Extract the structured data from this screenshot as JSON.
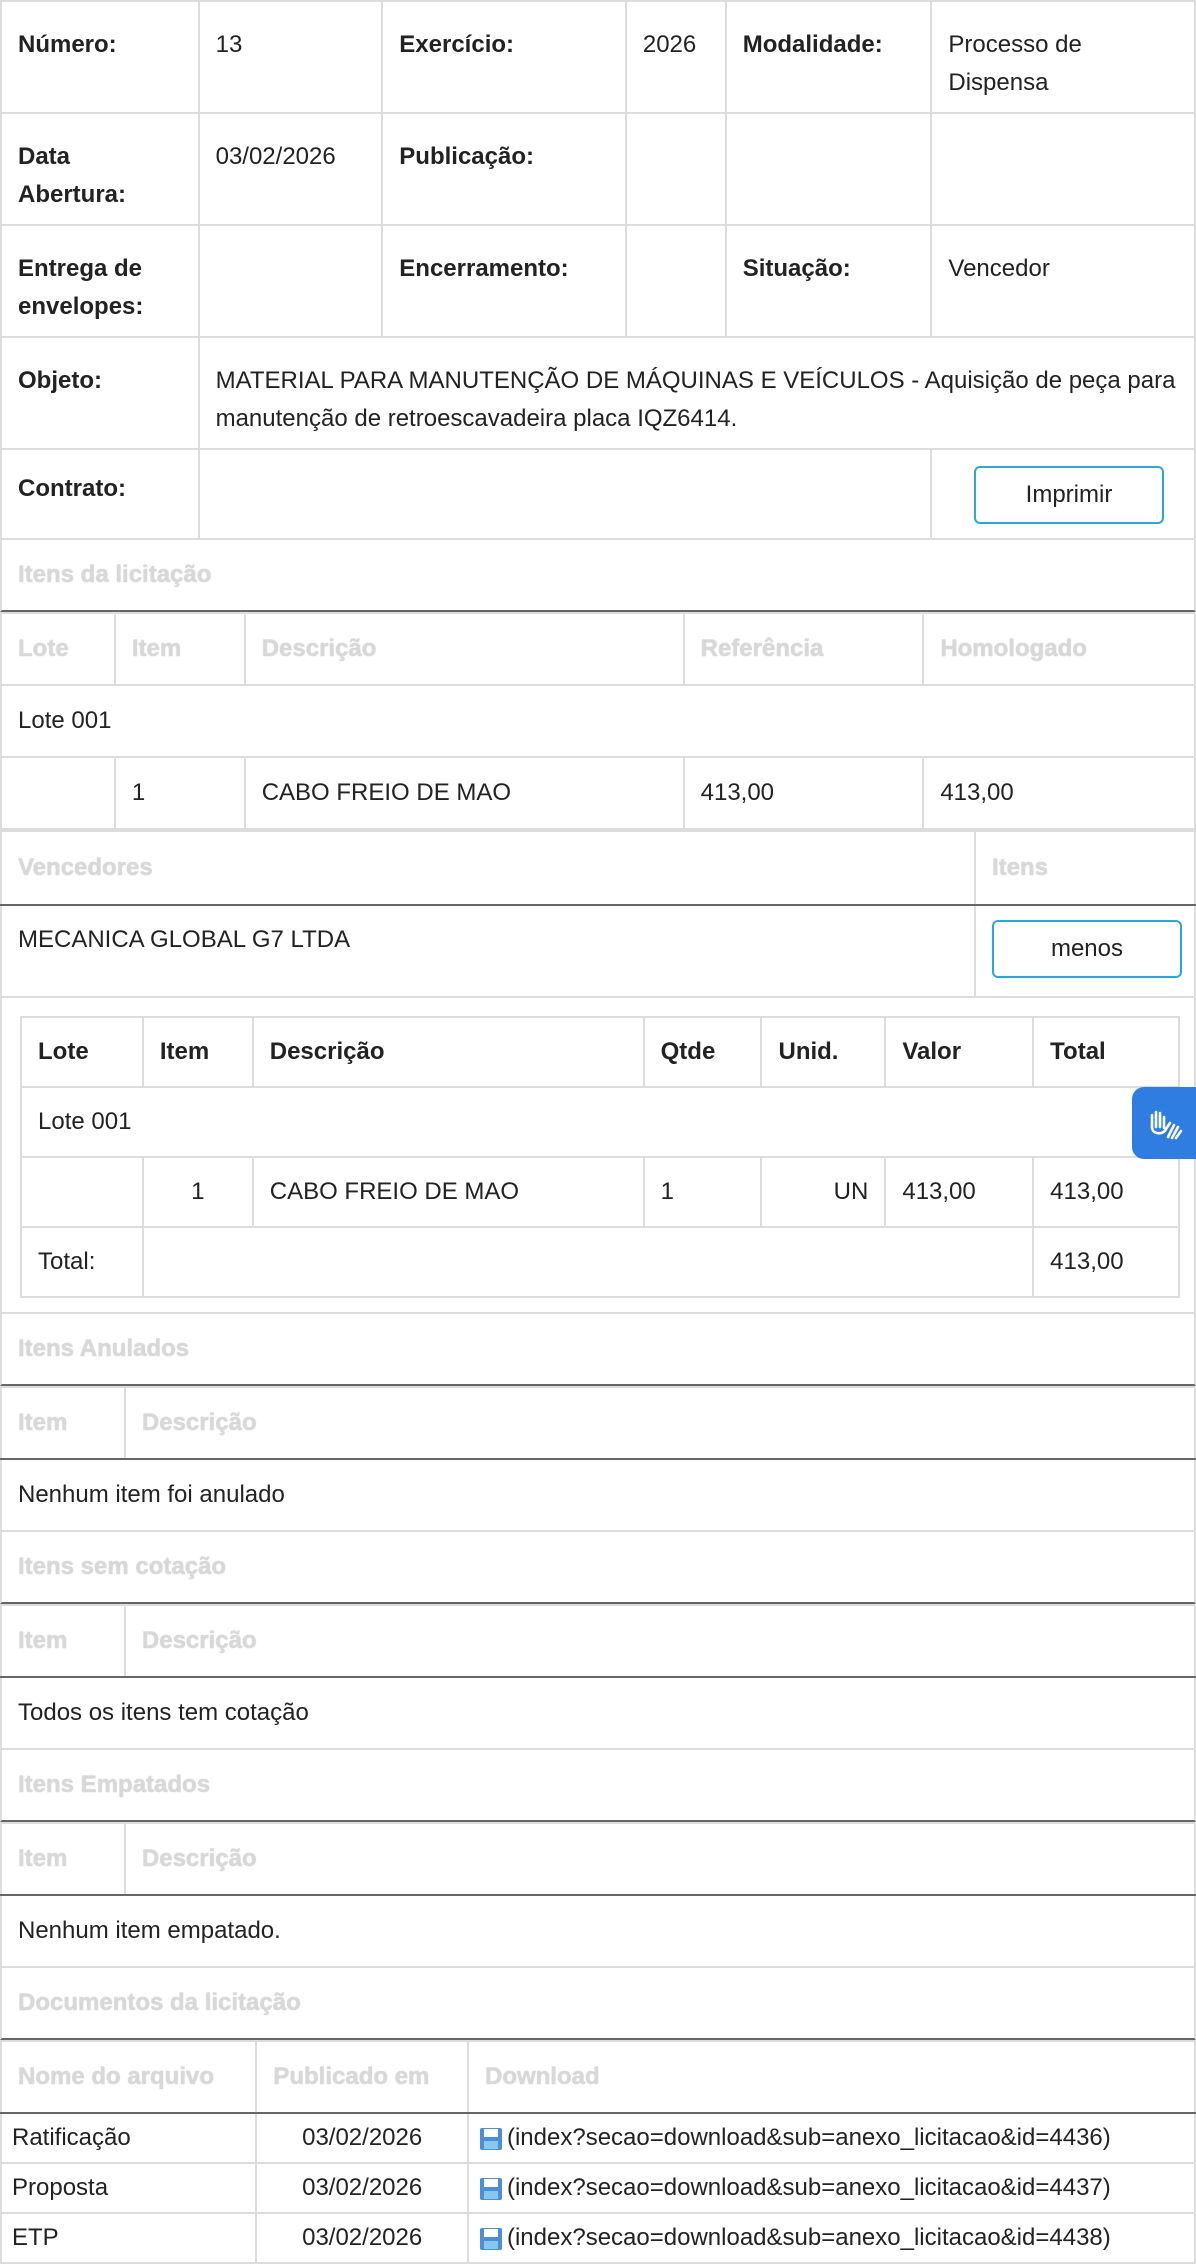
{
  "info": {
    "numero_label": "Número:",
    "numero": "13",
    "exercicio_label": "Exercício:",
    "exercicio": "2026",
    "modalidade_label": "Modalidade:",
    "modalidade": "Processo de Dispensa",
    "abertura_label": "Data Abertura:",
    "abertura": "03/02/2026",
    "publicacao_label": "Publicação:",
    "publicacao": "",
    "entrega_label": "Entrega de envelopes:",
    "entrega": "",
    "encerramento_label": "Encerramento:",
    "encerramento": "",
    "situacao_label": "Situação:",
    "situacao": "Vencedor",
    "objeto_label": "Objeto:",
    "objeto": "MATERIAL PARA MANUTENÇÃO DE MÁQUINAS E VEÍCULOS - Aquisição de peça para manutenção de retroescavadeira placa IQZ6414.",
    "contrato_label": "Contrato:",
    "contrato": "",
    "print_button": "Imprimir"
  },
  "itens_licitacao": {
    "title": "Itens da licitação",
    "headers": [
      "Lote",
      "Item",
      "Descrição",
      "Referência",
      "Homologado"
    ],
    "lote": "Lote 001",
    "row": {
      "item": "1",
      "descricao": "CABO FREIO DE MAO",
      "referencia": "413,00",
      "homologado": "413,00"
    }
  },
  "vencedores": {
    "title": "Vencedores",
    "itens_title": "Itens",
    "name": "MECANICA GLOBAL G7 LTDA",
    "toggle_button": "menos",
    "headers": [
      "Lote",
      "Item",
      "Descrição",
      "Qtde",
      "Unid.",
      "Valor",
      "Total"
    ],
    "lote": "Lote 001",
    "row": {
      "item": "1",
      "descricao": "CABO FREIO DE MAO",
      "qtde": "1",
      "unid": "UN",
      "valor": "413,00",
      "total": "413,00"
    },
    "total_label": "Total:",
    "total": "413,00"
  },
  "anulados": {
    "title": "Itens Anulados",
    "headers": [
      "Item",
      "Descrição"
    ],
    "message": "Nenhum item foi anulado"
  },
  "sem_cotacao": {
    "title": "Itens sem cotação",
    "headers": [
      "Item",
      "Descrição"
    ],
    "message": "Todos os itens tem cotação"
  },
  "empatados": {
    "title": "Itens Empatados",
    "headers": [
      "Item",
      "Descrição"
    ],
    "message": "Nenhum item empatado."
  },
  "documentos": {
    "title": "Documentos da licitação",
    "headers": [
      "Nome do arquivo",
      "Publicado em",
      "Download"
    ],
    "rows": [
      {
        "nome": "Ratificação",
        "data": "03/02/2026",
        "link": "(index?secao=download&sub=anexo_licitacao&id=4436)"
      },
      {
        "nome": "Proposta",
        "data": "03/02/2026",
        "link": "(index?secao=download&sub=anexo_licitacao&id=4437)"
      },
      {
        "nome": "ETP",
        "data": "03/02/2026",
        "link": "(index?secao=download&sub=anexo_licitacao&id=4438)"
      }
    ]
  },
  "icons": {
    "download": "floppy-disk-icon",
    "accessibility": "sign-language-hands-icon"
  },
  "colors": {
    "button_border": "#2aa9d6",
    "accessibility": "#2f7de1"
  }
}
